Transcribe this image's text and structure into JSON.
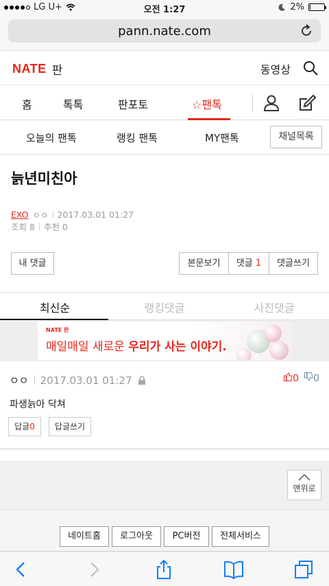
{
  "status_bar": {
    "carrier": "LG U+",
    "time": "오전 1:27",
    "battery": "2%",
    "battery_level": 0.02
  },
  "browser": {
    "url": "pann.nate.com"
  },
  "header": {
    "logo": "NATE",
    "section": "판",
    "video_link": "동영상"
  },
  "main_nav": {
    "tabs": [
      "홈",
      "톡톡",
      "판포토",
      "팬톡"
    ],
    "active": "팬톡"
  },
  "sub_nav": {
    "items": [
      "오늘의 팬톡",
      "랭킹 팬톡",
      "MY팬톡"
    ],
    "channel_button": "채널목록"
  },
  "post": {
    "title": "늙년미친아",
    "category": "EXO",
    "author": "ㅇㅇ",
    "date": "2017.03.01 01:27",
    "views": "조회 8",
    "recommends": "추천 0"
  },
  "post_actions": {
    "my_comments": "내 댓글",
    "view_body": "본문보기",
    "comments_label": "댓글",
    "comments_count": "1",
    "write_comment": "댓글쓰기"
  },
  "comment_tabs": [
    "최신순",
    "랭킹댓글",
    "사진댓글"
  ],
  "ad": {
    "brand": "NATE 판",
    "copy_normal": "매일매일 새로운 ",
    "copy_bold": "우리가 사는 이야기."
  },
  "comment": {
    "author": "ㅇㅇ",
    "date": "2017.03.01 01:27",
    "likes": "0",
    "dislikes": "0",
    "text": "파생늙아 닥쳐",
    "reply_label": "답글",
    "reply_count": "0",
    "write_reply": "답글쓰기"
  },
  "to_top": "맨위로",
  "footer": [
    "네이트홈",
    "로그아웃",
    "PC버전",
    "전체서비스"
  ],
  "colors": {
    "accent": "#e4261b"
  }
}
